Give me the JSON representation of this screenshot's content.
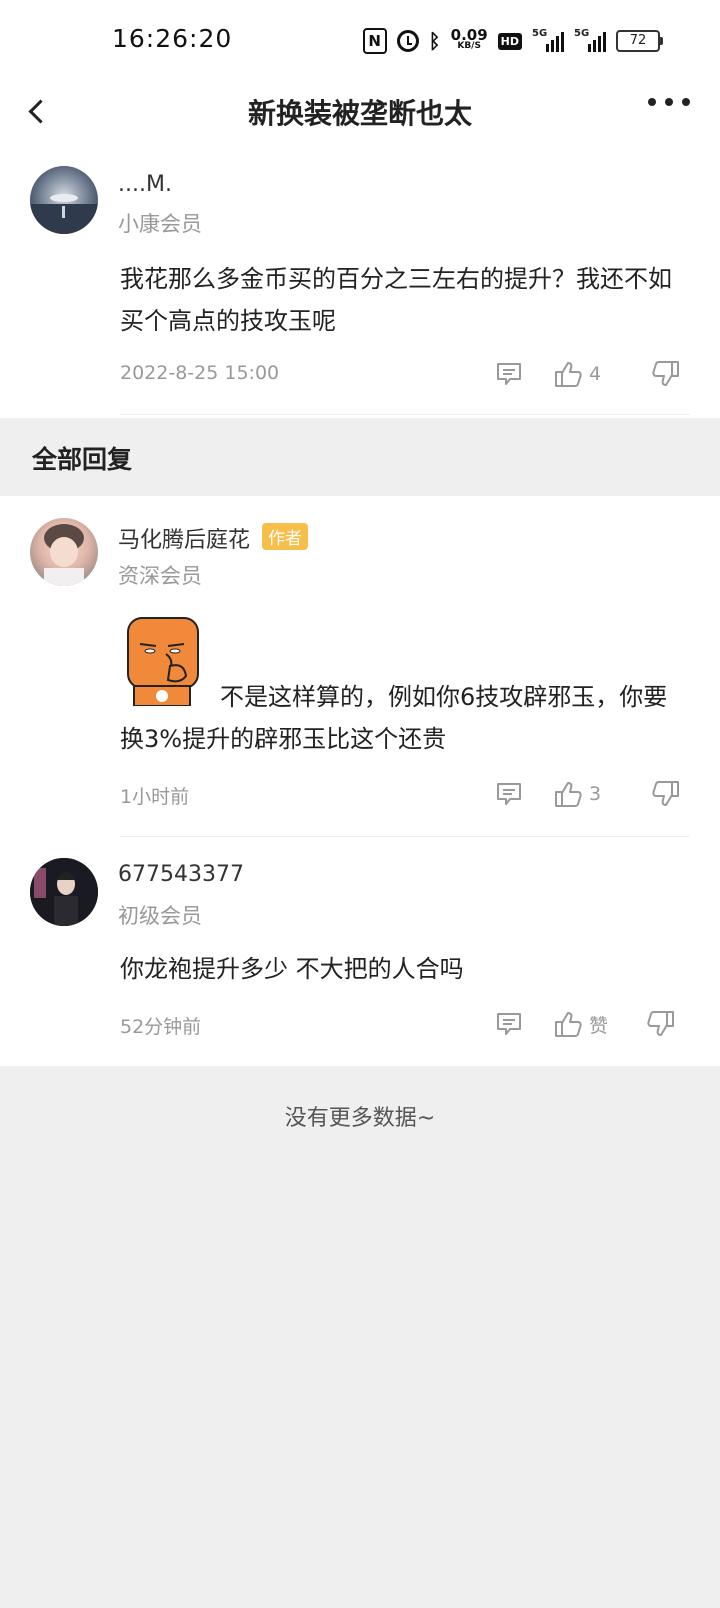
{
  "status_bar": {
    "time": "16:26:20",
    "net_speed": "0.09",
    "net_unit": "KB/S",
    "hd": "HD",
    "sig1": "5G",
    "sig2": "5G",
    "battery": "72"
  },
  "nav": {
    "title": "新换装被垄断也太"
  },
  "post": {
    "user": "....M.",
    "level": "小康会员",
    "content": "我花那么多金币买的百分之三左右的提升？我还不如买个高点的技攻玉呢",
    "time": "2022-8-25 15:00",
    "likes": "4"
  },
  "section": {
    "title": "全部回复"
  },
  "replies": [
    {
      "user": "马化腾后庭花",
      "badge": "作者",
      "level": "资深会员",
      "content": "不是这样算的，例如你6技攻辟邪玉，你要换3%提升的辟邪玉比这个还贵",
      "time": "1小时前",
      "likes": "3"
    },
    {
      "user": "677543377",
      "level": "初级会员",
      "content": "你龙袍提升多少 不大把的人合吗",
      "time": "52分钟前",
      "likes": "赞"
    }
  ],
  "footer": {
    "text": "没有更多数据~"
  },
  "colors": {
    "badge": "#f7bf4a",
    "muted": "#999999",
    "background": "#efefef"
  }
}
